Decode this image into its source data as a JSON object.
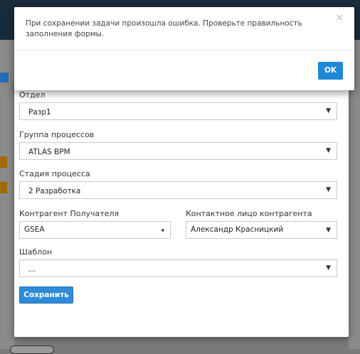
{
  "alert": {
    "message": "При сохранении задачи произошла ошибка. Проверьте правильность заполнения формы.",
    "close_symbol": "×",
    "ok_label": "OK"
  },
  "form": {
    "department": {
      "label": "Отдел",
      "value": "Разр1"
    },
    "process_group": {
      "label": "Группа процессов",
      "value": "ATLAS BPM"
    },
    "process_stage": {
      "label": "Стадия процесса",
      "value": "2 Разработка"
    },
    "recipient": {
      "label": "Контрагент Получателя",
      "value": "GSEA"
    },
    "contact": {
      "label": "Контактное лицо контрагента",
      "value": "Александр Красницкий"
    },
    "template": {
      "label": "Шаблон",
      "value": "..."
    },
    "save_label": "Сохранить"
  },
  "icons": {
    "chevron": "chevron-down-icon",
    "close": "close-icon"
  }
}
